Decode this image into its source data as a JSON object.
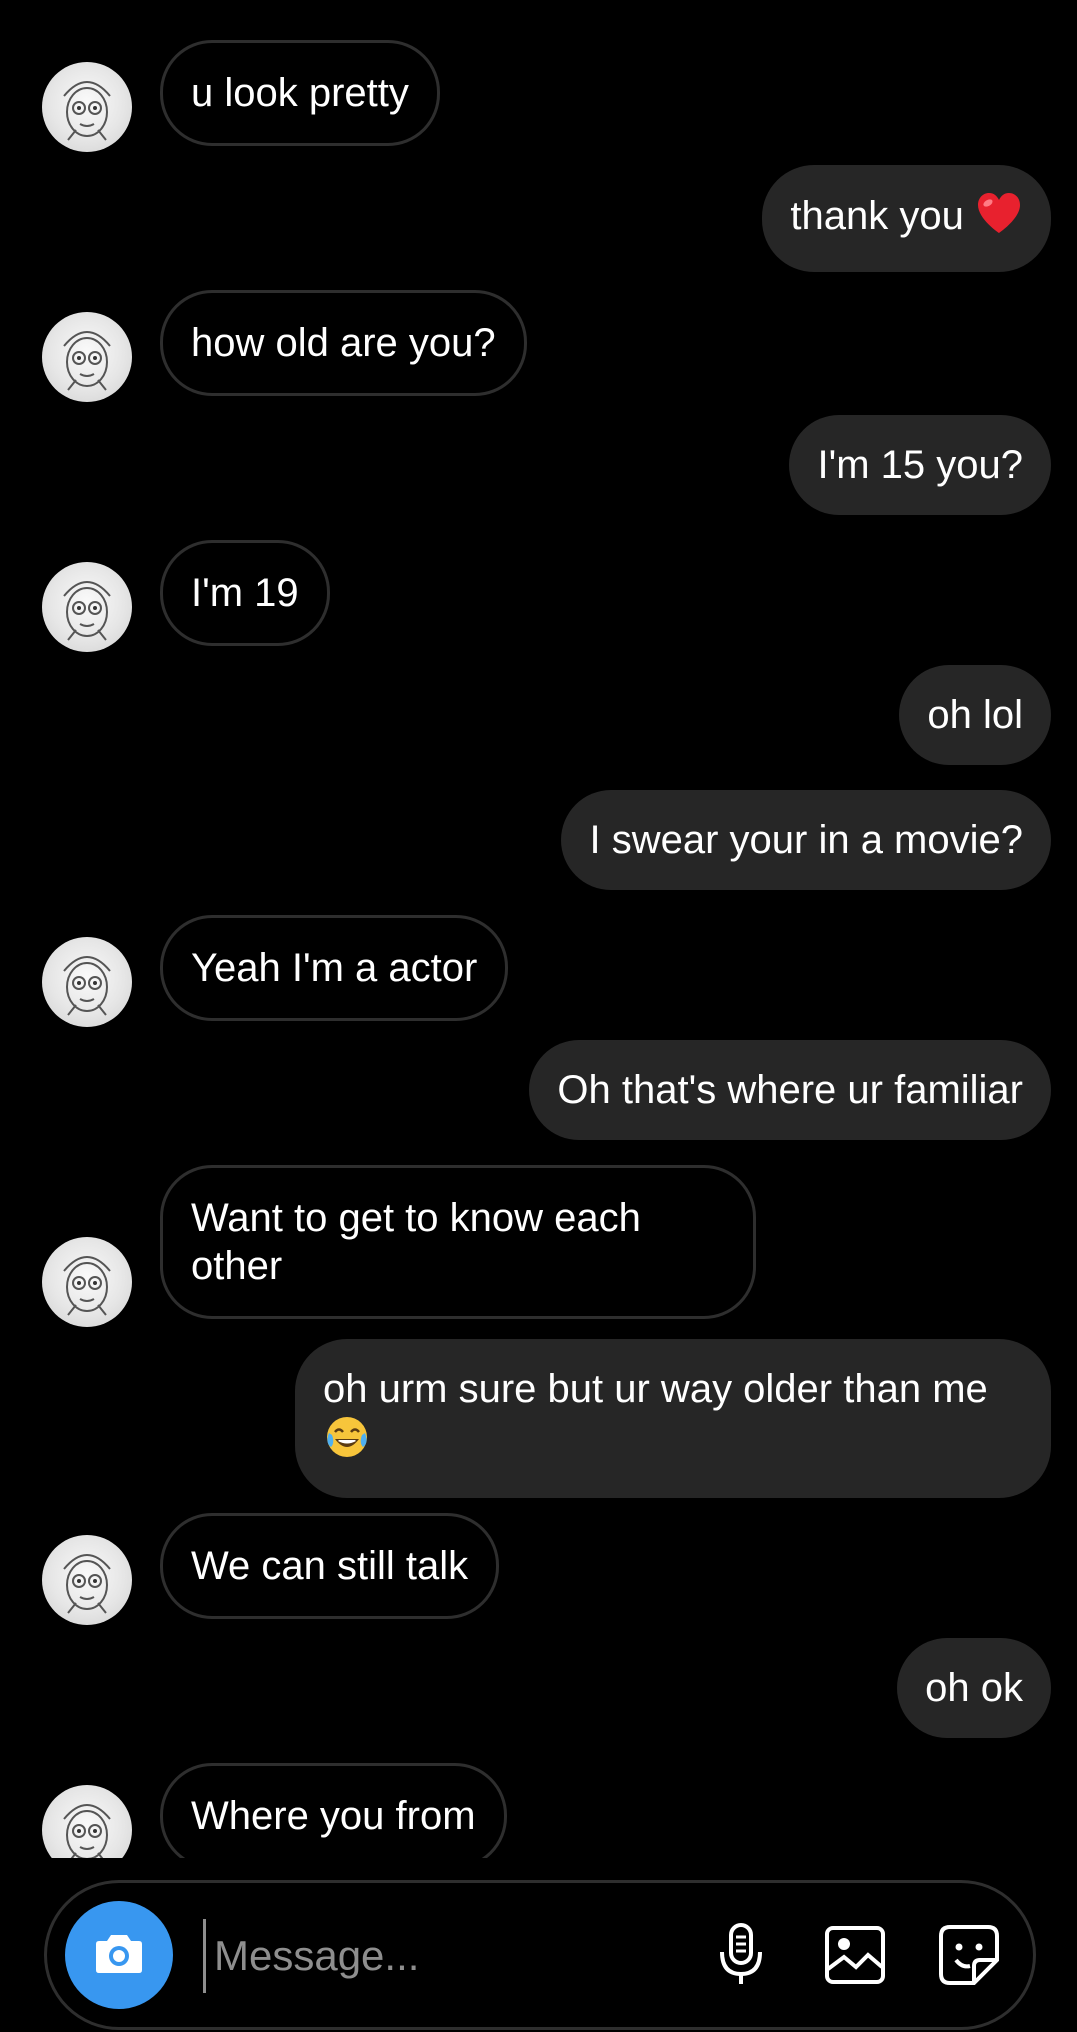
{
  "messages": [
    {
      "side": "in",
      "text": "u look pretty"
    },
    {
      "side": "out",
      "text": "thank you",
      "emoji": "heart"
    },
    {
      "side": "in",
      "text": "how old are you?"
    },
    {
      "side": "out",
      "text": "I'm 15 you?"
    },
    {
      "side": "in",
      "text": "I'm 19"
    },
    {
      "side": "out",
      "text": "oh lol"
    },
    {
      "side": "out",
      "text": "I swear your in a movie?"
    },
    {
      "side": "in",
      "text": "Yeah I'm a actor"
    },
    {
      "side": "out",
      "text": "Oh that's where ur familiar"
    },
    {
      "side": "in",
      "text": "Want to get to know each other"
    },
    {
      "side": "out",
      "text": "oh urm sure but ur way older than me",
      "emoji": "laughing"
    },
    {
      "side": "in",
      "text": "We can still talk"
    },
    {
      "side": "out",
      "text": "oh ok"
    },
    {
      "side": "in",
      "text": "Where you from"
    }
  ],
  "composer": {
    "placeholder": "Message...",
    "value": "",
    "icons": [
      "camera-icon",
      "microphone-icon",
      "gallery-icon",
      "sticker-icon"
    ]
  },
  "colors": {
    "background": "#000000",
    "outgoing_bubble": "#262626",
    "incoming_border": "#2e2e2e",
    "camera_button": "#3897f0",
    "placeholder": "#8e8e8e"
  }
}
